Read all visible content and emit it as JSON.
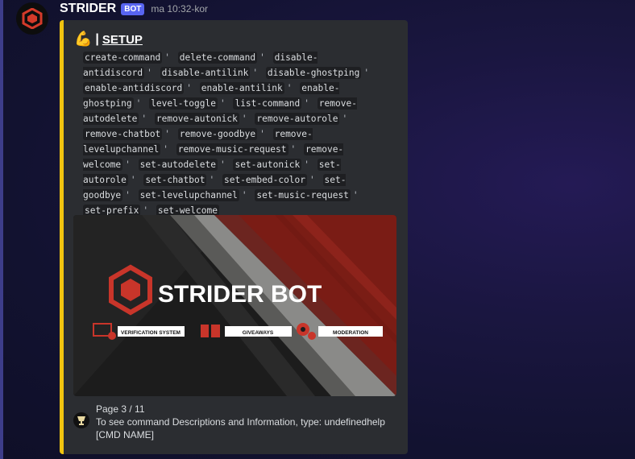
{
  "message": {
    "username": "STRIDER",
    "bot_tag": "BOT",
    "timestamp": "ma 10:32-kor"
  },
  "embed": {
    "accent_color": "#f1c40f",
    "title_emoji": "💪",
    "title_separator": "|",
    "title": "SETUP",
    "commands": [
      "create-command",
      "delete-command",
      "disable-antidiscord",
      "disable-antilink",
      "disable-ghostping",
      "enable-antidiscord",
      "enable-antilink",
      "enable-ghostping",
      "level-toggle",
      "list-command",
      "remove-autodelete",
      "remove-autonick",
      "remove-autorole",
      "remove-chatbot",
      "remove-goodbye",
      "remove-levelupchannel",
      "remove-music-request",
      "remove-welcome",
      "set-autodelete",
      "set-autonick",
      "set-autorole",
      "set-chatbot",
      "set-embed-color",
      "set-goodbye",
      "set-levelupchannel",
      "set-music-request",
      "set-prefix",
      "set-welcome"
    ],
    "banner": {
      "logo_text": "STRIDER BOT",
      "features": [
        "VERIFICATION SYSTEM",
        "GIVEAWAYS",
        "MODERATION"
      ],
      "colors": {
        "red": "#7a1c15",
        "dark": "#1b1b1b",
        "grey": "#6b6b6b"
      }
    },
    "footer": {
      "page": "Page 3 / 11",
      "hint": "To see command Descriptions and Information, type: undefinedhelp [CMD NAME]"
    }
  }
}
